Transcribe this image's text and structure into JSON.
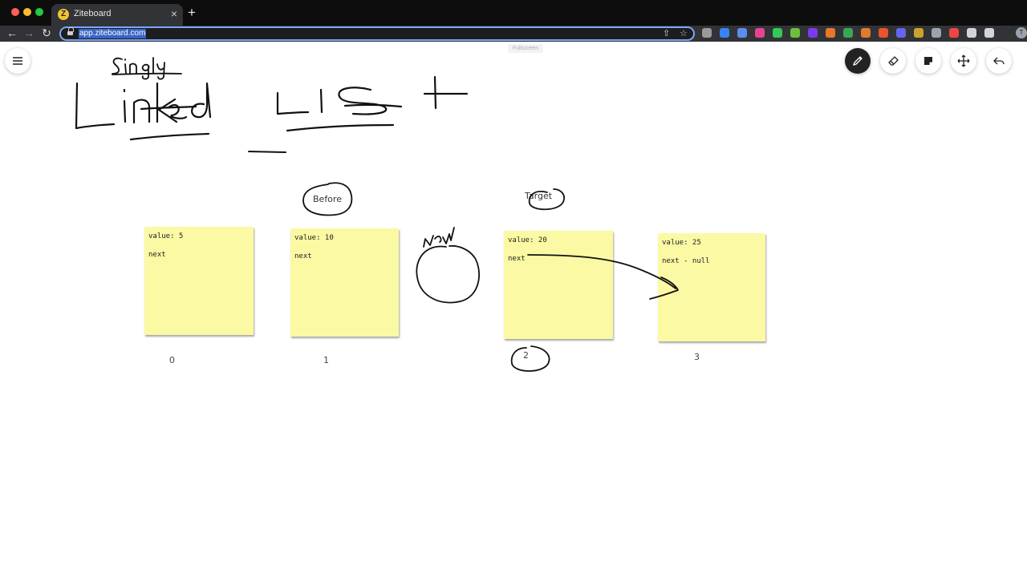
{
  "browser": {
    "tab_title": "Ziteboard",
    "favicon_letter": "Z",
    "tab_close": "×",
    "new_tab": "+",
    "url": "app.ziteboard.com",
    "profile_initial": "T",
    "nav_icons": [
      "back-arrow-icon",
      "forward-arrow-icon",
      "reload-icon"
    ],
    "extension_colors": [
      "#9a9a9a",
      "#3b82f6",
      "#5b8def",
      "#e84393",
      "#34c759",
      "#6bbf3b",
      "#7c3aed",
      "#e8762b",
      "#3aa655",
      "#e07a2e",
      "#e8542b",
      "#6366f1",
      "#c9a227",
      "#9ca3af",
      "#ef4444",
      "#d1d5db",
      "#d1d5db"
    ]
  },
  "app": {
    "fullscreen_label": "Fullscreen",
    "tools": [
      "menu-icon",
      "pen-icon",
      "eraser-icon",
      "sticky-note-icon",
      "move-icon",
      "undo-icon"
    ],
    "active_tool": "pen"
  },
  "notes": [
    {
      "value": "value: 5",
      "next": "next",
      "index": "0"
    },
    {
      "value": "value: 10",
      "next": "next",
      "index": "1"
    },
    {
      "value": "value: 20",
      "next": "next",
      "index": "2"
    },
    {
      "value": "value: 25",
      "next": "next - null",
      "index": "3"
    }
  ],
  "labels": {
    "before": "Before",
    "target": "Target"
  },
  "colors": {
    "sticky_note": "#fbf9a3",
    "ink": "#111111",
    "url_focus": "#7aa7f7"
  }
}
